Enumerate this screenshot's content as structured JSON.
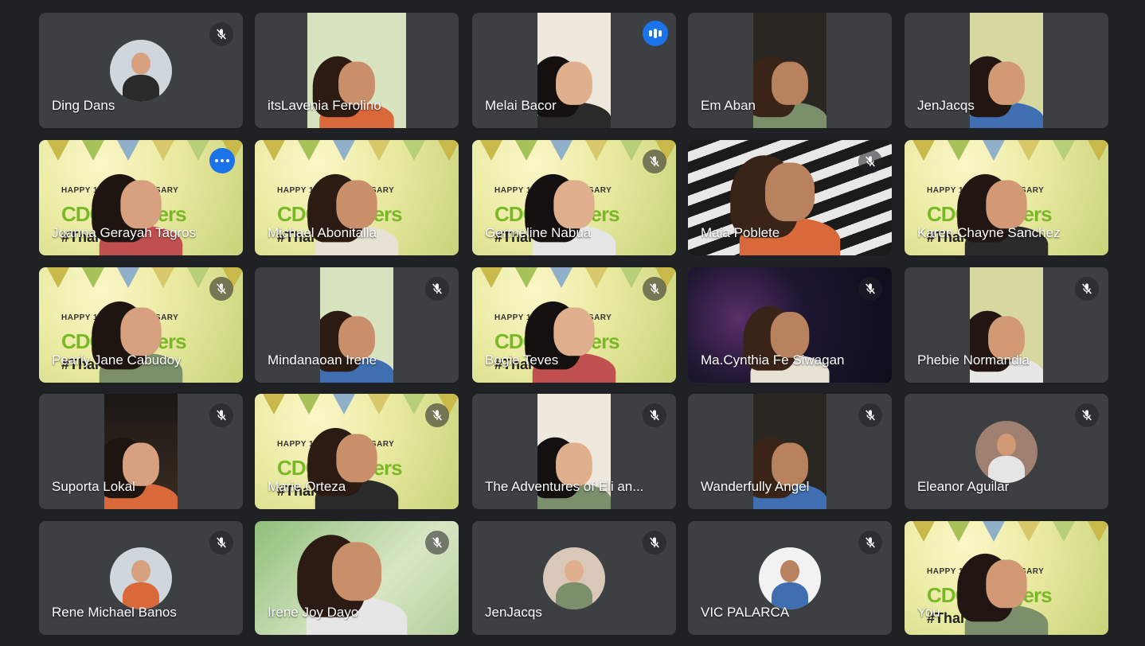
{
  "meeting": {
    "participants": [
      {
        "name": "Ding Dans",
        "view": "avatar",
        "muted": true
      },
      {
        "name": "itsLavenia Ferolino",
        "view": "portrait",
        "muted": false
      },
      {
        "name": "Melai Bacor",
        "view": "portrait",
        "muted": false,
        "speaking": true
      },
      {
        "name": "Em Aban",
        "view": "portrait",
        "muted": false
      },
      {
        "name": "JenJacqs",
        "view": "portrait",
        "muted": false
      },
      {
        "name": "Joanna Gerayah Tagros",
        "view": "banner",
        "muted": false,
        "active": true,
        "more_options": true
      },
      {
        "name": "Michael Abonitalla",
        "view": "banner",
        "muted": false
      },
      {
        "name": "Germeline Nabua",
        "view": "banner",
        "muted": true
      },
      {
        "name": "Maia Poblete",
        "view": "full",
        "muted": true
      },
      {
        "name": "Karen Chayne Sanchez",
        "view": "banner",
        "muted": false
      },
      {
        "name": "Pearly Jane Cabudoy",
        "view": "banner",
        "muted": true
      },
      {
        "name": "Mindanaoan Irene",
        "view": "portrait",
        "muted": true
      },
      {
        "name": "Bogie Teves",
        "view": "banner",
        "muted": true
      },
      {
        "name": "Ma.Cynthia Fe Siwagan",
        "view": "fireworks",
        "muted": true
      },
      {
        "name": "Phebie Normandia",
        "view": "portrait",
        "muted": true
      },
      {
        "name": "Suporta Lokal",
        "view": "portrait-dark",
        "muted": true
      },
      {
        "name": "Marie Orteza",
        "view": "banner",
        "muted": true
      },
      {
        "name": "The Adventures of Eli an...",
        "view": "portrait",
        "muted": true
      },
      {
        "name": "Wanderfully Angel",
        "view": "portrait",
        "muted": true
      },
      {
        "name": "Eleanor Aguilar",
        "view": "avatar",
        "muted": true
      },
      {
        "name": "Rene Michael Banos",
        "view": "avatar",
        "muted": true
      },
      {
        "name": "Irene Joy Dayo",
        "view": "full",
        "muted": true
      },
      {
        "name": "JenJacqs",
        "view": "avatar",
        "muted": true
      },
      {
        "name": "VIC PALARCA",
        "view": "avatar",
        "muted": true
      },
      {
        "name": "You",
        "view": "banner",
        "muted": false
      }
    ]
  },
  "banner": {
    "line1": "HAPPY 13TH ANNIVERSARY",
    "line2": "CDObloggers",
    "line3": "#ThankThirteen"
  },
  "colors": {
    "background": "#202124",
    "tile": "#3c4043",
    "active_border": "#8ab4f8",
    "badge_blue": "#1a73e8",
    "banner_green": "#7ab82a"
  },
  "icons": {
    "muted": "mic-off-icon",
    "speaking": "audio-level-icon",
    "more": "more-options-icon"
  }
}
